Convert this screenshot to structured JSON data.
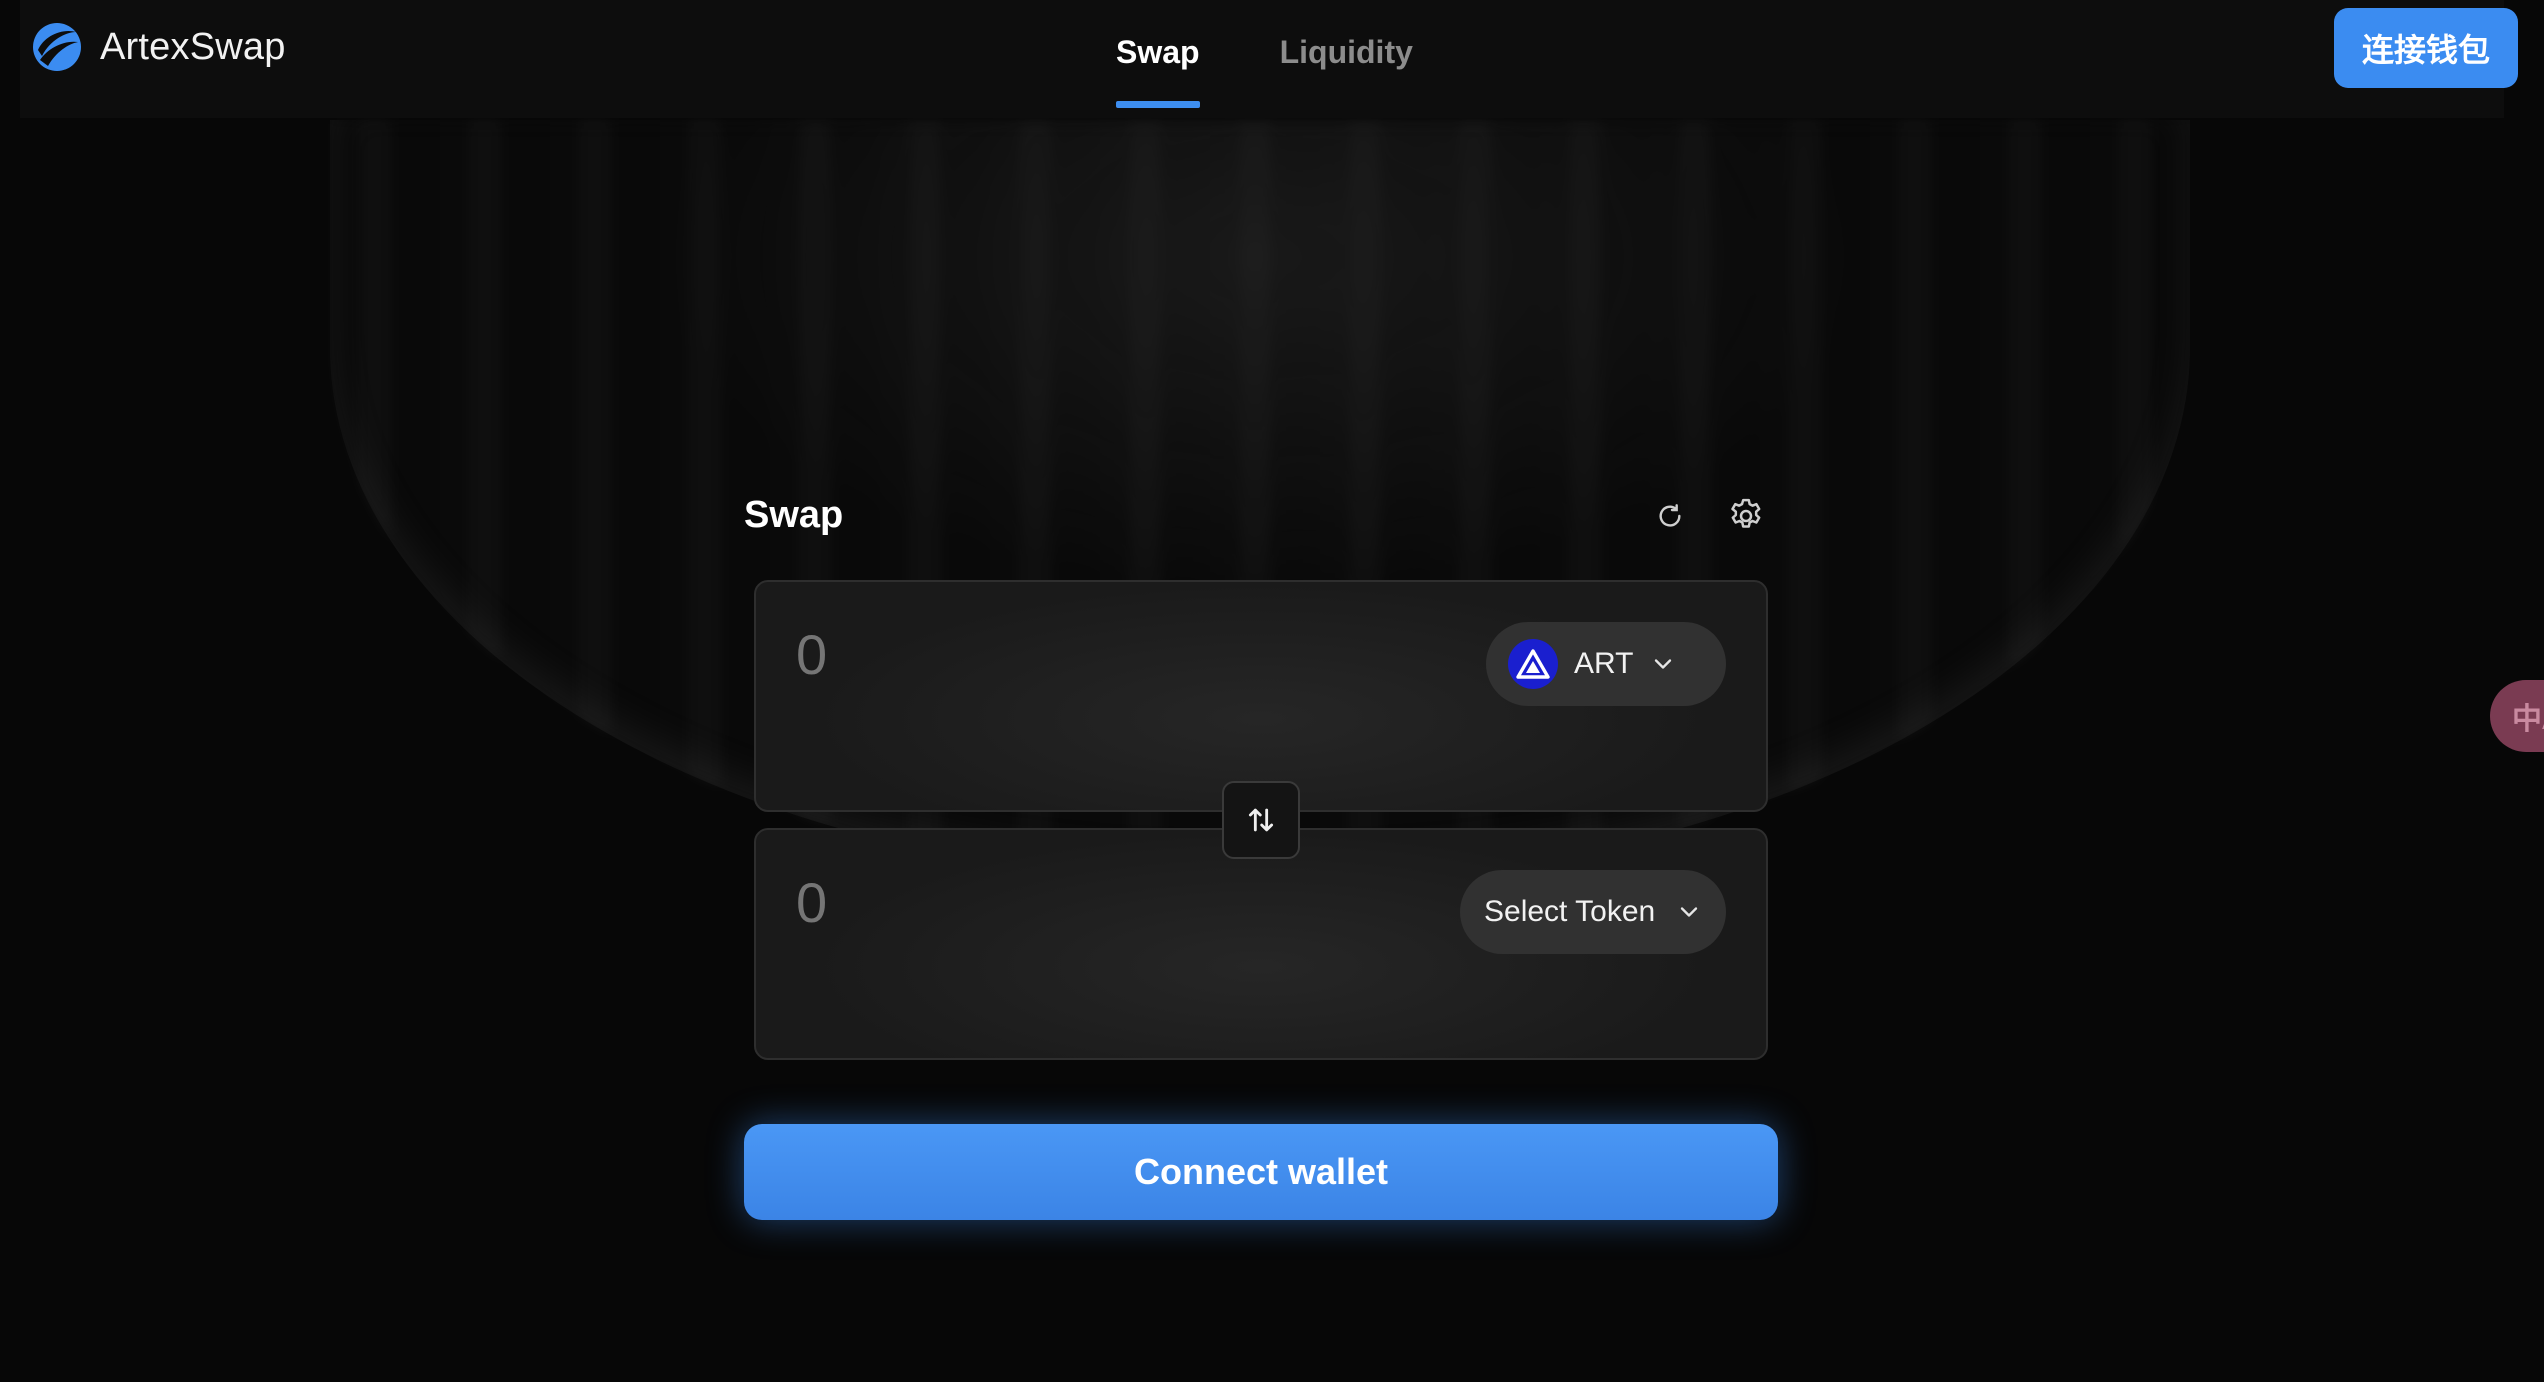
{
  "header": {
    "brand": "ArtexSwap",
    "tabs": [
      {
        "label": "Swap",
        "active": true
      },
      {
        "label": "Liquidity",
        "active": false
      }
    ],
    "connect_button": "连接钱包"
  },
  "swap": {
    "title": "Swap",
    "from": {
      "amount": "0",
      "token": "ART",
      "token_icon": "artex-token-icon"
    },
    "to": {
      "amount": "0",
      "token": "Select Token"
    },
    "connect_button": "Connect wallet"
  },
  "side_tab": {
    "label": "中A"
  },
  "colors": {
    "accent": "#3b8cf1",
    "background": "#070707",
    "panel": "#1e1e1e",
    "token_pill": "#313131",
    "art_token": "#1a1fcf",
    "side_tab": "#7a3b52"
  }
}
